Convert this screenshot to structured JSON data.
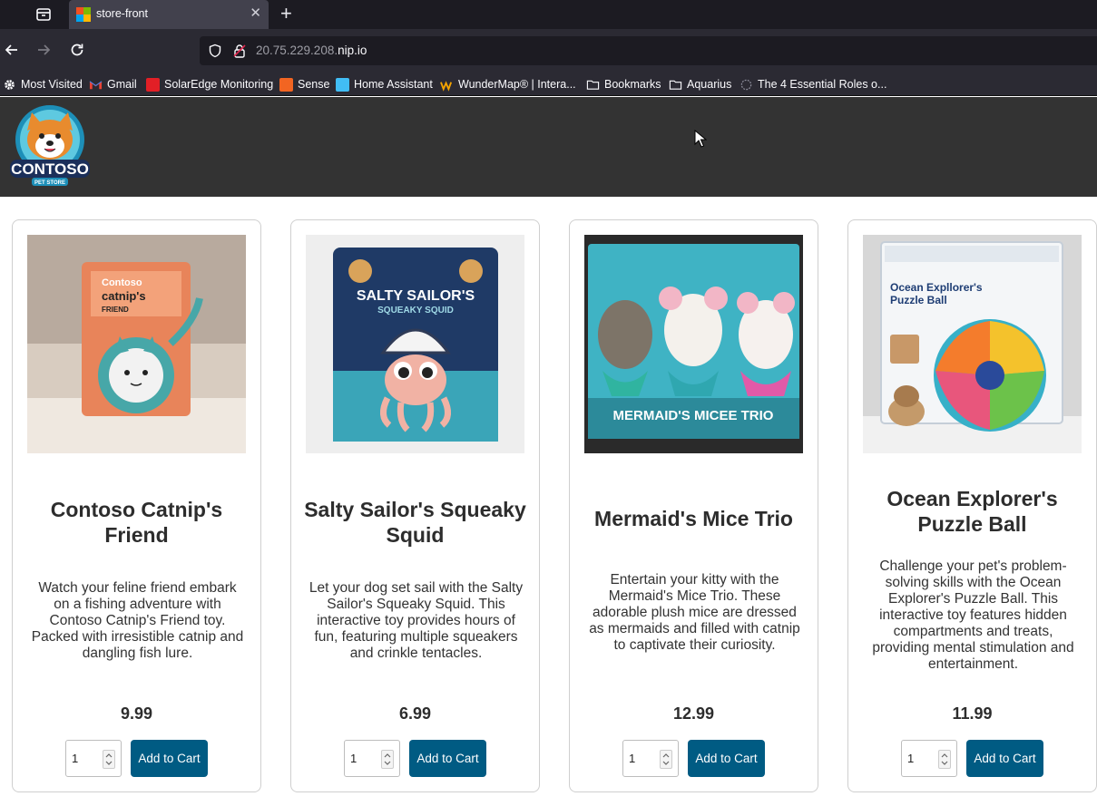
{
  "browser": {
    "tab": {
      "title": "store-front"
    },
    "url": {
      "prefix": "20.75.229.208.",
      "host": "nip.io"
    },
    "bookmarks": [
      {
        "label": "Most Visited",
        "icon": "gear-icon"
      },
      {
        "label": "Gmail",
        "icon": "gmail-icon"
      },
      {
        "label": "SolarEdge Monitoring",
        "icon": "solaredge-icon"
      },
      {
        "label": "Sense",
        "icon": "sense-icon"
      },
      {
        "label": "Home Assistant",
        "icon": "home-assistant-icon"
      },
      {
        "label": "WunderMap® | Intera...",
        "icon": "wunderground-icon"
      },
      {
        "label": "Bookmarks",
        "icon": "folder-icon"
      },
      {
        "label": "Aquarius",
        "icon": "folder-icon"
      },
      {
        "label": "The 4 Essential Roles o...",
        "icon": "globe-icon"
      }
    ]
  },
  "site": {
    "logo_text": "CONTOSO",
    "logo_subtext": "PET STORE"
  },
  "products": [
    {
      "name": "Contoso Catnip's Friend",
      "description": "Watch your feline friend embark on a fishing adventure with Contoso Catnip's Friend toy. Packed with irresistible catnip and dangling fish lure.",
      "price": "9.99",
      "quantity": "1",
      "button": "Add to Cart",
      "image_text": [
        "Contoso",
        "catnip's",
        "FRIEND"
      ]
    },
    {
      "name": "Salty Sailor's Squeaky Squid",
      "description": "Let your dog set sail with the Salty Sailor's Squeaky Squid. This interactive toy provides hours of fun, featuring multiple squeakers and crinkle tentacles.",
      "price": "6.99",
      "quantity": "1",
      "button": "Add to Cart",
      "image_text": [
        "SALTY SAILOR'S",
        "SQUEAKY SQUID"
      ]
    },
    {
      "name": "Mermaid's Mice Trio",
      "description": "Entertain your kitty with the Mermaid's Mice Trio. These adorable plush mice are dressed as mermaids and filled with catnip to captivate their curiosity.",
      "price": "12.99",
      "quantity": "1",
      "button": "Add to Cart",
      "image_text": [
        "MERMAID'S MICEE TRIO"
      ]
    },
    {
      "name": "Ocean Explorer's Puzzle Ball",
      "description": "Challenge your pet's problem-solving skills with the Ocean Explorer's Puzzle Ball. This interactive toy features hidden compartments and treats, providing mental stimulation and entertainment.",
      "price": "11.99",
      "quantity": "1",
      "button": "Add to Cart",
      "image_text": [
        "Ocean Expllorer's",
        "Puzzle Ball"
      ]
    }
  ]
}
